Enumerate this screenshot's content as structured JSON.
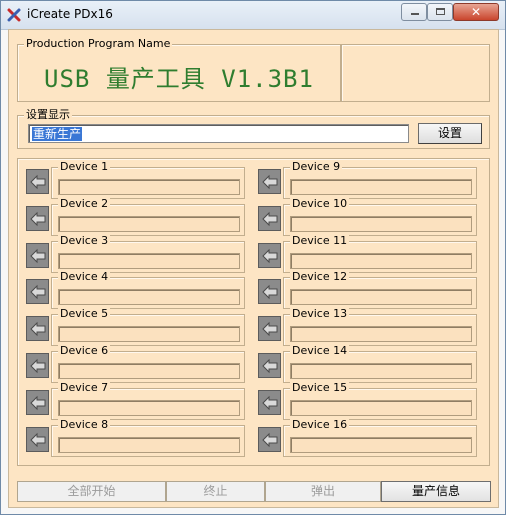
{
  "window": {
    "title": "iCreate PDx16",
    "close_symbol": "✕"
  },
  "program": {
    "group_label": "Production Program Name",
    "name": "USB 量产工具 V1.3B1"
  },
  "settings": {
    "group_label": "设置显示",
    "value": "重新生产",
    "button_label": "设置"
  },
  "devices_left": [
    {
      "label": "Device 1"
    },
    {
      "label": "Device 2"
    },
    {
      "label": "Device 3"
    },
    {
      "label": "Device 4"
    },
    {
      "label": "Device 5"
    },
    {
      "label": "Device 6"
    },
    {
      "label": "Device 7"
    },
    {
      "label": "Device 8"
    }
  ],
  "devices_right": [
    {
      "label": "Device 9"
    },
    {
      "label": "Device 10"
    },
    {
      "label": "Device 11"
    },
    {
      "label": "Device 12"
    },
    {
      "label": "Device 13"
    },
    {
      "label": "Device 14"
    },
    {
      "label": "Device 15"
    },
    {
      "label": "Device 16"
    }
  ],
  "footer": {
    "start_all": "全部开始",
    "stop": "终止",
    "eject": "弹出",
    "info": "量产信息"
  },
  "colors": {
    "panel_bg": "#fde5c4",
    "title_green": "#2f7d2f",
    "selection_blue": "#3a77d5"
  }
}
